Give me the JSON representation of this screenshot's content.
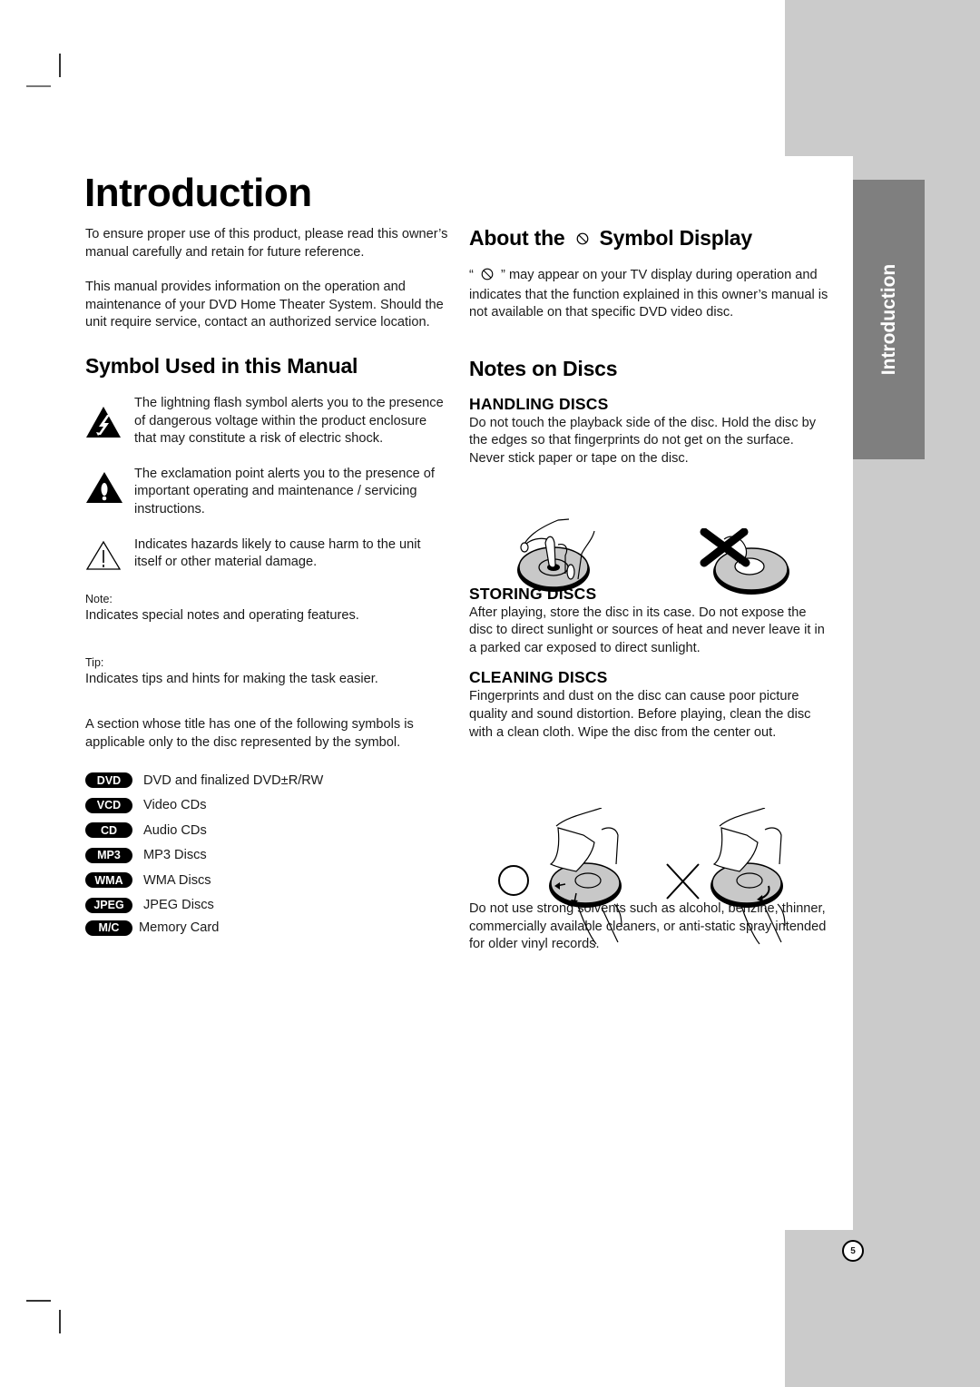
{
  "page": {
    "title": "Introduction",
    "side_tab_label": "Introduction",
    "page_number": "5"
  },
  "left_column": {
    "intro_paragraphs": [
      "To ensure proper use of this product, please read this owner’s manual carefully and retain for future reference.",
      "This manual provides information on the operation and maintenance of your DVD Home Theater System. Should the unit require service, contact an authorized service location."
    ],
    "symbol_section": {
      "heading": "Symbol Used in this Manual",
      "symbols": [
        {
          "icon": "lightning-warning-icon",
          "text": "The lightning flash symbol alerts you to the presence of dangerous voltage within the product enclosure that may constitute a risk of electric shock."
        },
        {
          "icon": "exclamation-warning-icon",
          "text": "The exclamation point alerts you to the presence of important operating and maintenance / servicing instructions."
        },
        {
          "icon": "caution-outline-icon",
          "text": "Indicates hazards likely to cause harm to the unit itself or other material damage."
        }
      ],
      "note_label": "Note:",
      "note_text": "Indicates special notes and operating features.",
      "tip_label": "Tip:",
      "tip_text": "Indicates tips and hints for making the task easier.",
      "disc_intro": "A section whose title has one of the following symbols is applicable only to the disc represented by the symbol.",
      "disc_types": [
        {
          "badge": "DVD",
          "label": "DVD and finalized DVD±R/RW"
        },
        {
          "badge": "VCD",
          "label": "Video CDs"
        },
        {
          "badge": "CD",
          "label": "Audio CDs"
        },
        {
          "badge": "MP3",
          "label": "MP3 Discs"
        },
        {
          "badge": "WMA",
          "label": "WMA Discs"
        },
        {
          "badge": "JPEG",
          "label": "JPEG Discs"
        },
        {
          "badge": "M/C",
          "label": "Memory Card"
        }
      ]
    }
  },
  "right_column": {
    "about_symbol": {
      "heading_before": "About the",
      "heading_after": "Symbol Display",
      "quote_open": "“",
      "quote_close": "”",
      "text": "may appear on your TV display during operation and indicates that the function explained in this owner’s manual is not available on that specific DVD video disc."
    },
    "notes_on_discs": {
      "heading": "Notes on Discs",
      "handling": {
        "heading": "HANDLING DISCS",
        "text": "Do not touch the playback side of the disc. Hold the disc by the edges so that fingerprints do not get on the surface. Never stick paper or tape on the disc."
      },
      "storing": {
        "heading": "STORING DISCS",
        "text": "After playing, store the disc in its case. Do not expose the disc to direct sunlight or sources of heat and never leave it in a parked car exposed to direct sunlight."
      },
      "cleaning": {
        "heading": "CLEANING DISCS",
        "text": "Fingerprints and dust on the disc can cause poor picture quality and sound distortion. Before playing, clean the disc with a clean cloth. Wipe the disc from the center out."
      },
      "solvents_warning": "Do not use strong solvents such as alcohol, benzine, thinner, commercially available cleaners, or anti-static spray intended for older vinyl records."
    }
  }
}
